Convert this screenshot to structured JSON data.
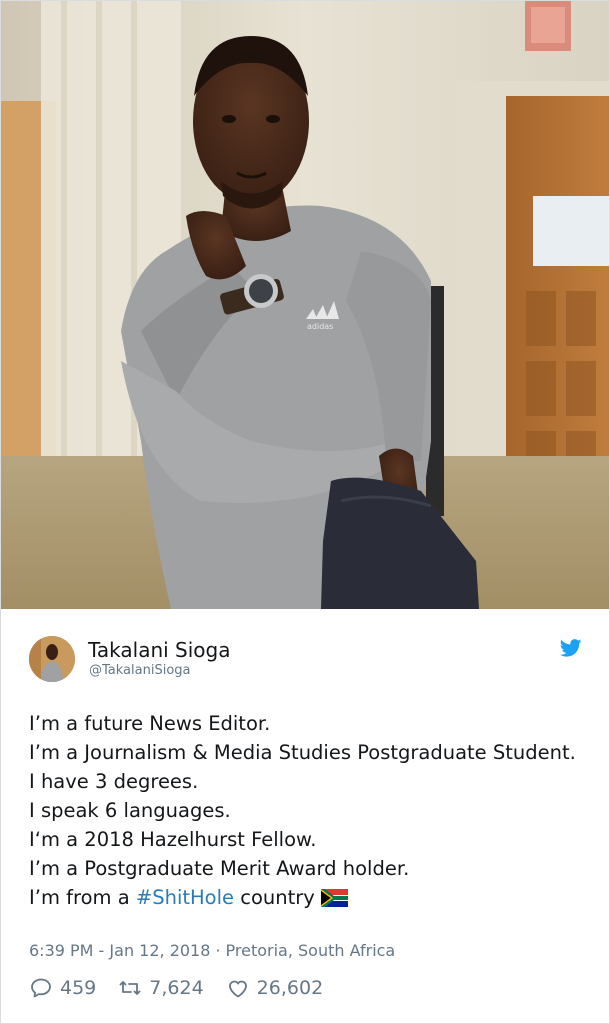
{
  "tweet": {
    "author": {
      "name": "Takalani Sioga",
      "handle": "@TakalaniSioga"
    },
    "body": {
      "line1": "I’m a future News Editor.",
      "line2": "I’m a Journalism & Media Studies Postgraduate Student.",
      "line3": "I have 3 degrees.",
      "line4": "I speak 6 languages.",
      "line5": "I‘m a 2018 Hazelhurst Fellow.",
      "line6": "I’m a Postgraduate Merit Award holder.",
      "line7_prefix": "I’m from a ",
      "hashtag": "#ShitHole",
      "line7_suffix": " country",
      "flag_icon": "south-africa-flag"
    },
    "timestamp": "6:39 PM - Jan 12, 2018",
    "separator": "·",
    "location": "Pretoria, South Africa",
    "stats": {
      "replies": "459",
      "retweets": "7,624",
      "likes": "26,602"
    }
  },
  "photo": {
    "shirt_brand": "adidas"
  },
  "colors": {
    "brand_blue": "#1da1f2",
    "hashtag_link": "#2b7bb9",
    "secondary_text": "#657786"
  }
}
